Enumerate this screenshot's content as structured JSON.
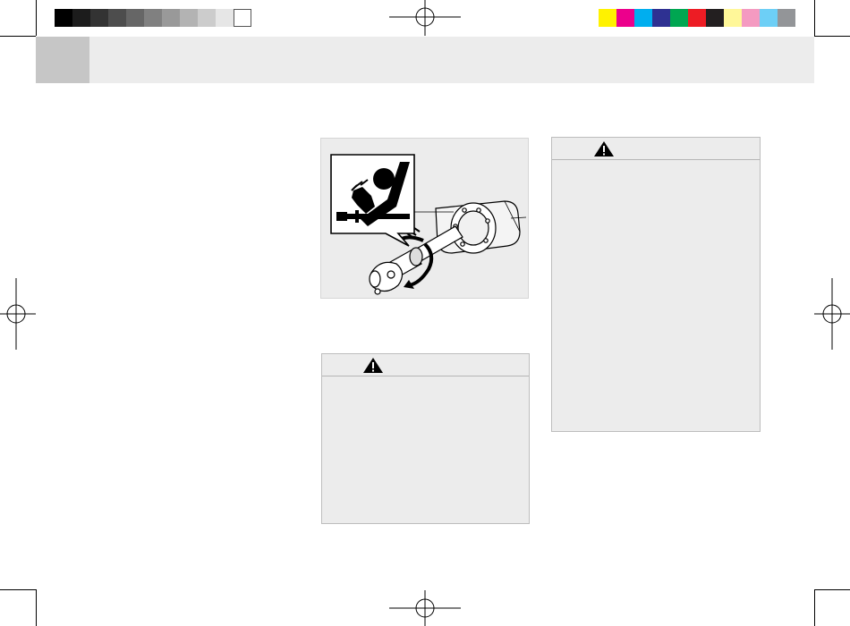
{
  "printer_marks": {
    "gray_swatches": [
      "#000000",
      "#1c1c1c",
      "#333333",
      "#4d4d4d",
      "#666666",
      "#808080",
      "#999999",
      "#b3b3b3",
      "#cccccc",
      "#e6e6e6",
      "#ffffff"
    ],
    "color_swatches": [
      "#fff200",
      "#ec008c",
      "#00aeef",
      "#2e3192",
      "#00a651",
      "#ed1c24",
      "#231f20",
      "#fff799",
      "#f49ac1",
      "#6dcff6",
      "#939598"
    ]
  },
  "header": {
    "band_color": "#ececec",
    "tab_color": "#c6c6c6"
  },
  "figure": {
    "safety_pictogram": "hand-entanglement-warning-icon",
    "illustration": "rotating-driveshaft-pto-coupling"
  },
  "warnings": [
    {
      "icon": "warning-triangle-icon"
    },
    {
      "icon": "warning-triangle-icon"
    }
  ]
}
